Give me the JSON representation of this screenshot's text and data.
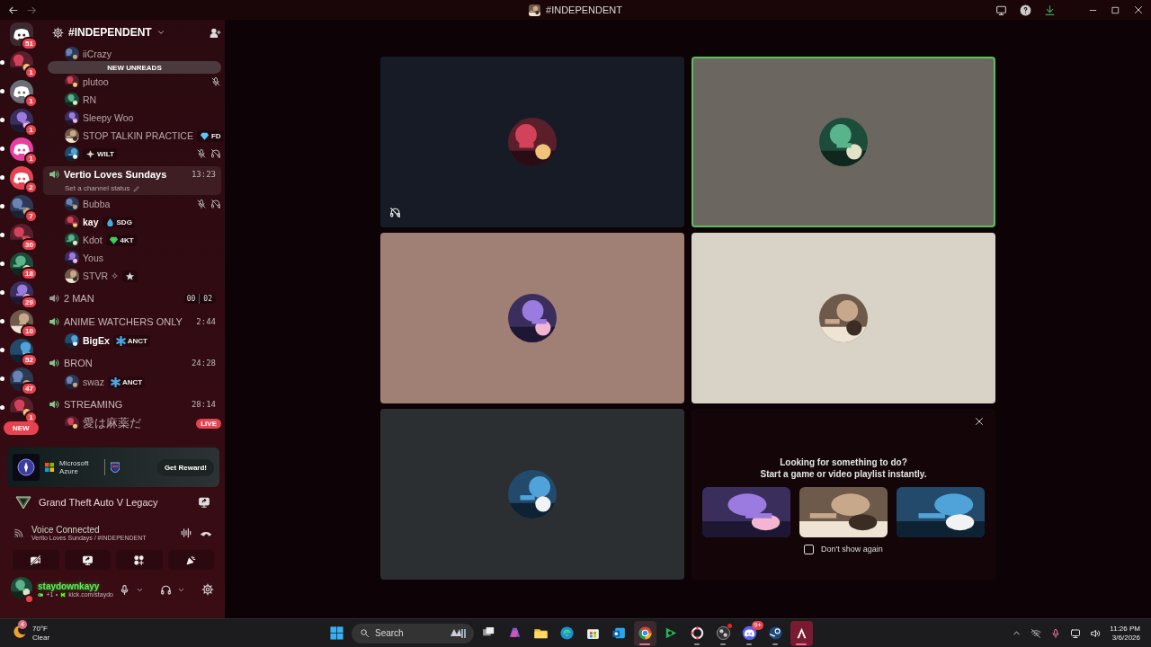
{
  "titlebar": {
    "title": "#INDEPENDENT"
  },
  "servers": [
    {
      "kind": "home",
      "color": "#3d2a30",
      "badge": "51",
      "unread": false
    },
    {
      "kind": "picture",
      "badge": "1",
      "unread": true
    },
    {
      "kind": "logo",
      "color": "#6d6f78",
      "badge": "1",
      "unread": true
    },
    {
      "kind": "picture",
      "badge": "1",
      "unread": true
    },
    {
      "kind": "logo",
      "color": "#e83fa0",
      "badge": "1",
      "unread": true
    },
    {
      "kind": "logo",
      "color": "#e5434f",
      "badge": "2",
      "unread": true
    },
    {
      "kind": "picture",
      "badge": "7",
      "unread": true
    },
    {
      "kind": "picture",
      "badge": "30",
      "unread": true
    },
    {
      "kind": "picture",
      "badge": "18",
      "unread": true
    },
    {
      "kind": "picture",
      "badge": "29",
      "unread": true
    },
    {
      "kind": "picture",
      "badge": "10",
      "unread": true
    },
    {
      "kind": "picture",
      "badge": "52",
      "unread": true
    },
    {
      "kind": "picture",
      "badge": "47",
      "unread": true
    },
    {
      "kind": "picture",
      "badge": "1",
      "unread": true
    }
  ],
  "new_pill": "NEW",
  "guild": {
    "name": "#INDEPENDENT"
  },
  "new_unreads": "NEW UNREADS",
  "members_above": [
    {
      "name": "iiCrazy",
      "highlighted": false,
      "muted": false,
      "deafened": false
    },
    {
      "name": "plutoo",
      "highlighted": false,
      "muted": true,
      "deafened": false
    },
    {
      "name": "RN",
      "highlighted": false,
      "muted": false,
      "deafened": false
    },
    {
      "name": "Sleepy Woo",
      "highlighted": false,
      "muted": false,
      "deafened": false
    },
    {
      "name": "STOP TALKIN PRACTICE",
      "tag": {
        "kind": "gem",
        "text": "FD",
        "color": "#5ac8fa"
      },
      "highlighted": false,
      "muted": false,
      "deafened": false
    },
    {
      "tag": {
        "kind": "sparkle",
        "text": "WILT"
      },
      "muted": true,
      "deafened": true
    }
  ],
  "channels": [
    {
      "name": "Vertio Loves Sundays",
      "timer": "13:23",
      "status": "Set a channel status",
      "selected": true,
      "active": true,
      "users": [
        {
          "name": "Bubba",
          "highlighted": false,
          "muted": true,
          "deafened": true
        },
        {
          "name": "kay",
          "tag": {
            "kind": "drop",
            "text": "SDG",
            "color": "#4aa8e8"
          },
          "highlighted": true,
          "muted": false,
          "deafened": false
        },
        {
          "name": "Kdot",
          "tag": {
            "kind": "gem",
            "text": "4KT",
            "color": "#3ccf5a"
          },
          "highlighted": false,
          "muted": false,
          "deafened": false
        },
        {
          "name": "Yous",
          "highlighted": false,
          "muted": false,
          "deafened": false
        },
        {
          "name": "STVR ✧",
          "tag": {
            "kind": "star"
          },
          "highlighted": false,
          "muted": false,
          "deafened": false
        }
      ]
    },
    {
      "name": "2 MAN",
      "limit": [
        "00",
        "02"
      ],
      "selected": false,
      "active": false
    },
    {
      "name": "ANIME WATCHERS ONLY",
      "timer": "2:44",
      "selected": false,
      "active": true,
      "users": [
        {
          "name": "BigEx",
          "tag": {
            "kind": "snowflake",
            "text": "ANCT",
            "color": "#4aa8e8"
          },
          "highlighted": true,
          "muted": false,
          "deafened": false
        }
      ]
    },
    {
      "name": "BRON",
      "timer": "24:28",
      "selected": false,
      "active": true,
      "users": [
        {
          "name": "swaz",
          "tag": {
            "kind": "snowflake",
            "text": "ANCT",
            "color": "#4aa8e8"
          },
          "highlighted": false,
          "muted": false,
          "deafened": false
        }
      ]
    },
    {
      "name": "STREAMING",
      "timer": "28:14",
      "selected": false,
      "active": true,
      "users": [
        {
          "name": "愛は麻薬だ",
          "live": "LIVE",
          "highlighted": false,
          "muted": false,
          "deafened": false
        }
      ]
    }
  ],
  "promo": {
    "brand": "Microsoft Azure",
    "button": "Get Reward!"
  },
  "activity": {
    "game": "Grand Theft Auto V Legacy"
  },
  "voice": {
    "status": "Voice Connected",
    "location": "Vertio Loves Sundays / #INDEPENDENT"
  },
  "voice_buttons": [
    {
      "kind": "camera_off"
    },
    {
      "kind": "screen"
    },
    {
      "kind": "activities"
    },
    {
      "kind": "soundboard"
    }
  ],
  "user": {
    "name": "staydownkayy",
    "extra": "+1",
    "link": "kick.com/staydo"
  },
  "tiles": [
    {
      "color": "#161b26",
      "speaking": false,
      "deafened": true
    },
    {
      "color": "#6b6760",
      "speaking": true,
      "deafened": false
    },
    {
      "color": "#a07f74",
      "speaking": false,
      "deafened": false
    },
    {
      "color": "#d9d2c6",
      "speaking": false,
      "deafened": false
    },
    {
      "color": "#2b2f31",
      "speaking": false,
      "deafened": false
    }
  ],
  "activity_panel": {
    "heading": "Looking for something to do?",
    "sub": "Start a game or video playlist instantly.",
    "checkbox": {
      "label": "Don't show again",
      "checked": false
    }
  },
  "taskbar": {
    "weather": {
      "temp": "70°F",
      "condition": "Clear",
      "badge": "4"
    },
    "search": {
      "placeholder": "Search"
    },
    "apps": [
      {
        "kind": "taskview",
        "open": false,
        "focused": false
      },
      {
        "kind": "copilot",
        "open": false,
        "focused": false
      },
      {
        "kind": "folder",
        "open": false,
        "focused": false
      },
      {
        "kind": "edge",
        "open": false,
        "focused": false
      },
      {
        "kind": "store",
        "open": false,
        "focused": false
      },
      {
        "kind": "mail",
        "open": false,
        "focused": false
      },
      {
        "kind": "chrome",
        "open": true,
        "focused": true
      },
      {
        "kind": "play",
        "open": false,
        "focused": false
      },
      {
        "kind": "ring",
        "open": true,
        "focused": false
      },
      {
        "kind": "obs",
        "open": true,
        "focused": false,
        "alert": true
      },
      {
        "kind": "discord",
        "open": true,
        "focused": false,
        "badge": "9+"
      },
      {
        "kind": "steam",
        "open": true,
        "focused": false
      },
      {
        "kind": "launcher",
        "open": true,
        "focused": true
      }
    ],
    "time": "11:26 PM",
    "date": "3/6/2026"
  }
}
